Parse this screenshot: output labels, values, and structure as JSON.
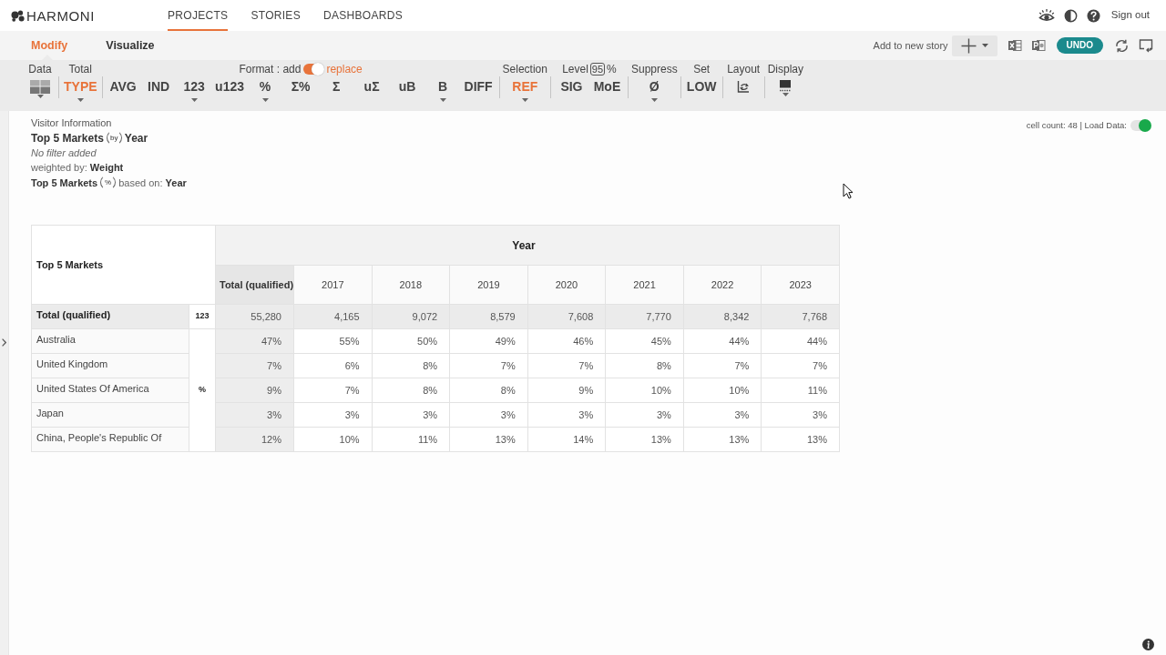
{
  "header": {
    "logo": "HARMONI",
    "nav": [
      {
        "label": "PROJECTS",
        "selected": true
      },
      {
        "label": "STORIES",
        "selected": false
      },
      {
        "label": "DASHBOARDS",
        "selected": false
      }
    ],
    "sign_out": "Sign out"
  },
  "mode_bar": {
    "tabs": [
      {
        "label": "Modify",
        "selected": true
      },
      {
        "label": "Visualize",
        "selected": false
      }
    ],
    "add_to_story": "Add to new story",
    "undo": "UNDO"
  },
  "toolbar": {
    "groups": [
      {
        "kind": "plain",
        "label": "Data",
        "buttons": [
          {
            "kind": "data_view",
            "dropdown": true,
            "active": false
          }
        ]
      },
      {
        "kind": "plain",
        "label": "Total",
        "buttons": [
          {
            "kind": "text",
            "text": "TYPE",
            "dropdown": true,
            "active": true
          }
        ]
      },
      {
        "kind": "format",
        "label": "Format : add",
        "toggle_on": true,
        "toggle_label": "replace",
        "buttons": [
          {
            "kind": "text",
            "text": "AVG",
            "dropdown": false,
            "active": false
          },
          {
            "kind": "text",
            "text": "IND",
            "dropdown": false,
            "active": false
          },
          {
            "kind": "text",
            "text": "123",
            "dropdown": true,
            "active": false
          },
          {
            "kind": "text",
            "text": "u123",
            "dropdown": false,
            "active": false
          },
          {
            "kind": "text",
            "text": "%",
            "dropdown": true,
            "active": false
          },
          {
            "kind": "text",
            "text": "Σ%",
            "dropdown": false,
            "active": false
          },
          {
            "kind": "text",
            "text": "Σ",
            "dropdown": false,
            "active": false
          },
          {
            "kind": "text",
            "text": "uΣ",
            "dropdown": false,
            "active": false
          },
          {
            "kind": "text",
            "text": "uB",
            "dropdown": false,
            "active": false
          },
          {
            "kind": "text",
            "text": "B",
            "dropdown": true,
            "active": false
          },
          {
            "kind": "text",
            "text": "DIFF",
            "dropdown": false,
            "active": false
          }
        ]
      },
      {
        "kind": "plain",
        "label": "Selection",
        "buttons": [
          {
            "kind": "text",
            "text": "REF",
            "dropdown": true,
            "active": true
          }
        ]
      },
      {
        "kind": "level",
        "label": "Level",
        "confidence": "95",
        "suffix": "%",
        "buttons": [
          {
            "kind": "text",
            "text": "SIG",
            "dropdown": false,
            "active": false
          },
          {
            "kind": "text",
            "text": "MoE",
            "dropdown": false,
            "active": false
          }
        ]
      },
      {
        "kind": "plain",
        "label": "Suppress",
        "buttons": [
          {
            "kind": "text",
            "text": "Ø",
            "dropdown": true,
            "active": false
          }
        ]
      },
      {
        "kind": "plain",
        "label": "Set",
        "buttons": [
          {
            "kind": "text",
            "text": "LOW",
            "dropdown": false,
            "active": false
          }
        ]
      },
      {
        "kind": "plain",
        "label": "Layout",
        "buttons": [
          {
            "kind": "layout",
            "dropdown": false,
            "active": false
          }
        ]
      },
      {
        "kind": "plain",
        "label": "Display",
        "buttons": [
          {
            "kind": "display",
            "dropdown": true,
            "active": false
          }
        ]
      }
    ]
  },
  "report": {
    "source": "Visitor Information",
    "rows_name": "Top 5 Markets",
    "by_text": "by",
    "cols_name": "Year",
    "filter": "No filter added",
    "weighting": "weighted by: **Weight**",
    "base_rows": "Top 5 Markets",
    "percent_text": "%",
    "basis": "based on: **Year**"
  },
  "status": {
    "cell_count": "cell count: 48 | Load Data:",
    "load_data_on": true
  },
  "table": {
    "corner": "Top 5 Markets",
    "group_header": "Year",
    "columns": [
      {
        "kind": "total",
        "label": "Total (qualified)"
      },
      {
        "kind": "year",
        "label": "2017"
      },
      {
        "kind": "year",
        "label": "2018"
      },
      {
        "kind": "year",
        "label": "2019"
      },
      {
        "kind": "year",
        "label": "2020"
      },
      {
        "kind": "year",
        "label": "2021"
      },
      {
        "kind": "year",
        "label": "2022"
      },
      {
        "kind": "year",
        "label": "2023"
      }
    ],
    "sections": [
      {
        "kind": "total",
        "type_label": "123",
        "rows": [
          {
            "label": "Total (qualified)",
            "values": [
              "55,280",
              "4,165",
              "9,072",
              "8,579",
              "7,608",
              "7,770",
              "8,342",
              "7,768"
            ]
          }
        ]
      },
      {
        "kind": "percent",
        "type_label": "%",
        "rows": [
          {
            "label": "Australia",
            "values": [
              "47%",
              "55%",
              "50%",
              "49%",
              "46%",
              "45%",
              "44%",
              "44%"
            ]
          },
          {
            "label": "United Kingdom",
            "values": [
              "7%",
              "6%",
              "8%",
              "7%",
              "7%",
              "8%",
              "7%",
              "7%"
            ]
          },
          {
            "label": "United States Of America",
            "values": [
              "9%",
              "7%",
              "8%",
              "8%",
              "9%",
              "10%",
              "10%",
              "11%"
            ]
          },
          {
            "label": "Japan",
            "values": [
              "3%",
              "3%",
              "3%",
              "3%",
              "3%",
              "3%",
              "3%",
              "3%"
            ]
          },
          {
            "label": "China, People's Republic Of",
            "values": [
              "12%",
              "10%",
              "11%",
              "13%",
              "14%",
              "13%",
              "13%",
              "13%"
            ]
          }
        ]
      }
    ]
  }
}
